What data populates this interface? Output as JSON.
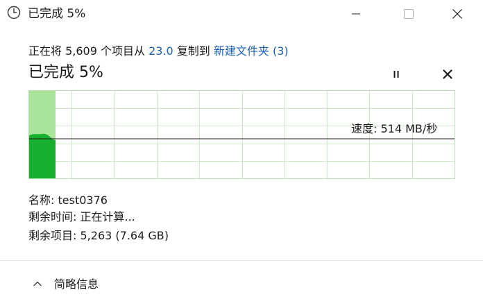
{
  "window": {
    "title": "已完成 5%",
    "icons": {
      "app": "clock-icon",
      "minimize": "minimize-icon",
      "maximize": "maximize-icon",
      "close": "close-icon"
    }
  },
  "copy": {
    "status_prefix": "正在将 5,609 个项目从 ",
    "source": "23.0",
    "status_middle": " 复制到 ",
    "destination": "新建文件夹 (3)",
    "progress_title": "已完成 5%",
    "progress_percent": 5,
    "pause_icon": "pause-icon",
    "cancel_icon": "cancel-icon"
  },
  "graph": {
    "speed_label": "速度: 514 MB/秒",
    "colors": {
      "fill_done": "#15b02d",
      "fill_area": "#a8e49a",
      "grid": "#cfe8ca",
      "line": "#1a1a1a"
    }
  },
  "details": {
    "name_label": "名称:",
    "name_value": "test0376",
    "time_label": "剩余时间:",
    "time_value": "正在计算...",
    "items_label": "剩余项目:",
    "items_value": "5,263 (7.64 GB)"
  },
  "footer": {
    "toggle_label": "简略信息",
    "toggle_icon": "chevron-up-icon"
  }
}
